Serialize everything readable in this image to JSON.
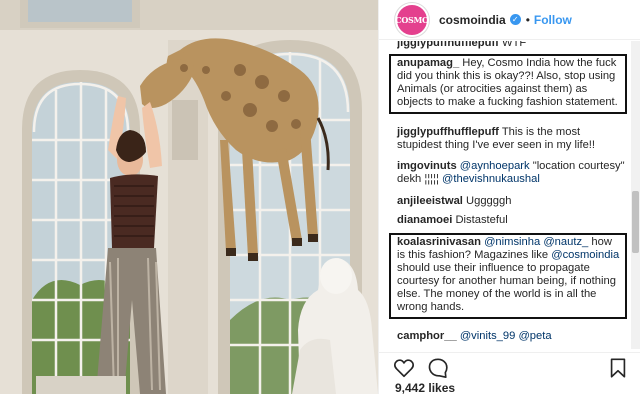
{
  "post": {
    "account": "cosmoindia",
    "avatar_text": "COSMO",
    "follow_label": "Follow",
    "separator": "•",
    "likes_text": "9,442 likes"
  },
  "comments": [
    {
      "user": "jigglypuffhufflepuff",
      "text": "WTF",
      "boxed": false
    },
    {
      "user": "anupamag_",
      "text": "Hey, Cosmo India how the fuck did you think this is okay??! Also, stop using Animals (or atrocities against them) as objects to make a fucking fashion statement.",
      "boxed": true
    },
    {
      "user": "jigglypuffhufflepuff",
      "text": "This is the most stupidest thing I've ever seen in my life!!",
      "boxed": false
    },
    {
      "user": "imgovinuts",
      "mention1": "@aynhoepark",
      "mid": "\"location courtesy\" dekh ¦¦¦¦¦",
      "mention2": "@thevishnukaushal",
      "boxed": false
    },
    {
      "user": "anjileeistwal",
      "text": "Ugggggh",
      "boxed": false
    },
    {
      "user": "dianamoei",
      "text": "Distasteful",
      "boxed": false
    },
    {
      "user": "koalasrinivasan",
      "mention1": "@nimsinha",
      "mention2": "@nautz_",
      "text1": "how is this fashion? Magazines like",
      "mention3": "@cosmoindia",
      "text2": "should use their influence to propagate courtesy for another human being, if nothing else. The money of the world is in all the wrong hands.",
      "boxed": true
    },
    {
      "user": "camphor__",
      "mention1": "@vinits_99",
      "mention2": "@peta",
      "boxed": false
    }
  ],
  "colors": {
    "link": "#3897f0",
    "mention": "#003569",
    "avatar": "#e4408e"
  },
  "icons": [
    "verified-badge-icon",
    "heart-icon",
    "comment-icon",
    "bookmark-icon"
  ]
}
